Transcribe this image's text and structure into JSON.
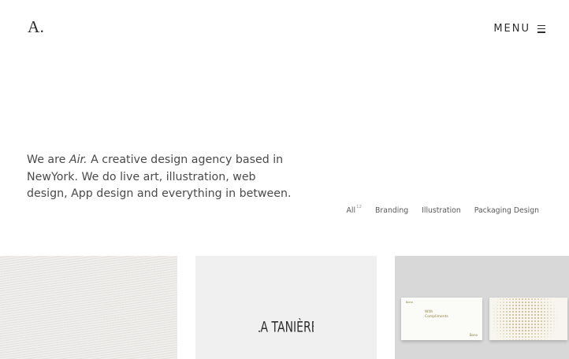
{
  "header": {
    "logo": "A.",
    "menu_label": "MENU",
    "menu_icon": "hamburger-icon"
  },
  "intro": {
    "prefix": "We are ",
    "brand": "Air.",
    "body": " A creative design agency based in NewYork. We do live art, illustration, web design, App design and everything in between."
  },
  "filters": {
    "items": [
      {
        "label": "All",
        "count": "12"
      },
      {
        "label": "Branding"
      },
      {
        "label": "Illustration"
      },
      {
        "label": "Packaging Design"
      }
    ]
  },
  "portfolio": {
    "tile_2_logo": "LA TANIÈRE",
    "tile_3_card_brand": "Bono",
    "tile_3_card_text_1": "With",
    "tile_3_card_text_2": "Compliments",
    "tile_3_card_foot": "Bono"
  },
  "colors": {
    "background": "#ffffff",
    "text": "#4a4a4a",
    "accent_gold": "#8b8240"
  }
}
